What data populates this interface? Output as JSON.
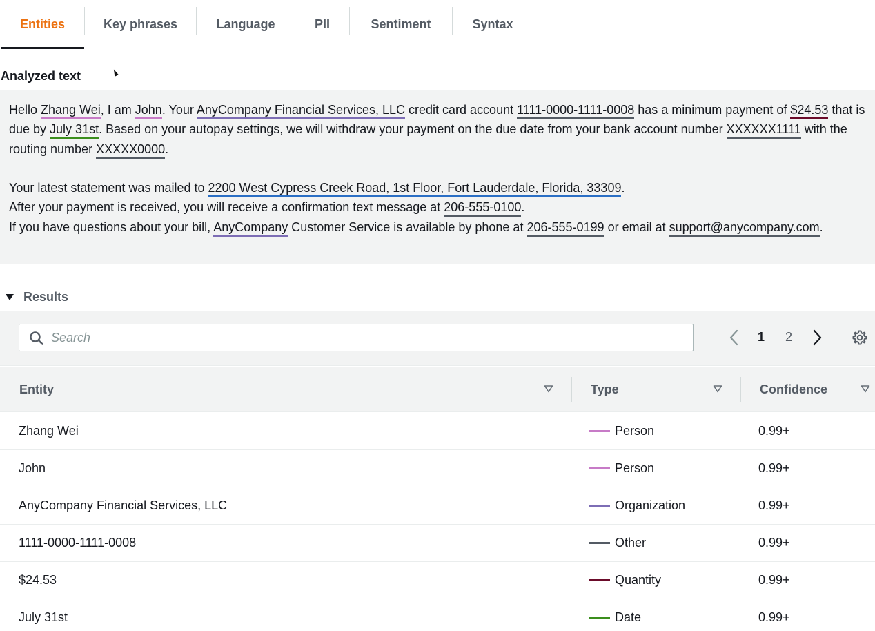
{
  "tabs": [
    {
      "label": "Entities",
      "active": true
    },
    {
      "label": "Key phrases",
      "active": false
    },
    {
      "label": "Language",
      "active": false
    },
    {
      "label": "PII",
      "active": false
    },
    {
      "label": "Sentiment",
      "active": false
    },
    {
      "label": "Syntax",
      "active": false
    }
  ],
  "analyzed_text": {
    "title": "Analyzed text",
    "p1": {
      "t0": "Hello ",
      "e_zhang": "Zhang Wei",
      "t1": ", I am ",
      "e_john": "John",
      "t2": ". Your ",
      "e_org": "AnyCompany Financial Services, LLC",
      "t3": " credit card account ",
      "e_card": "1111-0000-1111-0008",
      "t4": " has a minimum payment of ",
      "e_amount": "$24.53",
      "t5": " that is due by ",
      "e_date": "July 31st",
      "t6": ". Based on your autopay settings, we will withdraw your payment on the due date from your bank account number ",
      "e_account": "XXXXXX1111",
      "t7": " with the routing number ",
      "e_routing": "XXXXX0000",
      "t8": "."
    },
    "p2": {
      "t0": "Your latest statement was mailed to ",
      "e_address": "2200 West Cypress Creek Road, 1st Floor, Fort Lauderdale, Florida, 33309",
      "t1": "."
    },
    "p3": {
      "t0": "After your payment is received, you will receive a confirmation text message at ",
      "e_phone1": "206-555-0100",
      "t1": "."
    },
    "p4": {
      "t0": "If you have questions about your bill, ",
      "e_company": "AnyCompany",
      "t1": " Customer Service is available by phone at ",
      "e_phone2": "206-555-0199",
      "t2": " or email at ",
      "e_email": "support@anycompany.com",
      "t3": "."
    }
  },
  "results": {
    "title": "Results",
    "expanded": true,
    "search": {
      "placeholder": "Search",
      "value": "",
      "icon": "search-icon"
    },
    "pagination": {
      "current": "1",
      "next": "2",
      "prev_icon": "chevron-left-icon",
      "next_icon": "chevron-right-icon"
    },
    "settings_icon": "gear-icon",
    "columns": [
      "Entity",
      "Type",
      "Confidence"
    ],
    "rows": [
      {
        "entity": "Zhang Wei",
        "type": "Person",
        "color": "#c77bc7",
        "confidence": "0.99+"
      },
      {
        "entity": "John",
        "type": "Person",
        "color": "#c77bc7",
        "confidence": "0.99+"
      },
      {
        "entity": "AnyCompany Financial Services, LLC",
        "type": "Organization",
        "color": "#7d6db5",
        "confidence": "0.99+"
      },
      {
        "entity": "1111-0000-1111-0008",
        "type": "Other",
        "color": "#545b64",
        "confidence": "0.99+"
      },
      {
        "entity": "$24.53",
        "type": "Quantity",
        "color": "#6b0b2a",
        "confidence": "0.99+"
      },
      {
        "entity": "July 31st",
        "type": "Date",
        "color": "#3b8e1d",
        "confidence": "0.99+"
      }
    ]
  },
  "colors": {
    "accent": "#ec7211",
    "person": "#c77bc7",
    "organization": "#7d6db5",
    "other": "#545b64",
    "quantity": "#6b0b2a",
    "date": "#3b8e1d",
    "location": "#2b6fc5"
  }
}
